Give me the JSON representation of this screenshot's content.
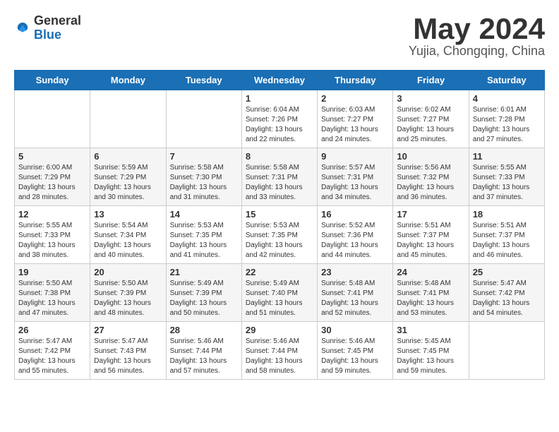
{
  "header": {
    "logo_general": "General",
    "logo_blue": "Blue",
    "month": "May 2024",
    "location": "Yujia, Chongqing, China"
  },
  "days_of_week": [
    "Sunday",
    "Monday",
    "Tuesday",
    "Wednesday",
    "Thursday",
    "Friday",
    "Saturday"
  ],
  "weeks": [
    [
      {
        "day": "",
        "info": ""
      },
      {
        "day": "",
        "info": ""
      },
      {
        "day": "",
        "info": ""
      },
      {
        "day": "1",
        "info": "Sunrise: 6:04 AM\nSunset: 7:26 PM\nDaylight: 13 hours\nand 22 minutes."
      },
      {
        "day": "2",
        "info": "Sunrise: 6:03 AM\nSunset: 7:27 PM\nDaylight: 13 hours\nand 24 minutes."
      },
      {
        "day": "3",
        "info": "Sunrise: 6:02 AM\nSunset: 7:27 PM\nDaylight: 13 hours\nand 25 minutes."
      },
      {
        "day": "4",
        "info": "Sunrise: 6:01 AM\nSunset: 7:28 PM\nDaylight: 13 hours\nand 27 minutes."
      }
    ],
    [
      {
        "day": "5",
        "info": "Sunrise: 6:00 AM\nSunset: 7:29 PM\nDaylight: 13 hours\nand 28 minutes."
      },
      {
        "day": "6",
        "info": "Sunrise: 5:59 AM\nSunset: 7:29 PM\nDaylight: 13 hours\nand 30 minutes."
      },
      {
        "day": "7",
        "info": "Sunrise: 5:58 AM\nSunset: 7:30 PM\nDaylight: 13 hours\nand 31 minutes."
      },
      {
        "day": "8",
        "info": "Sunrise: 5:58 AM\nSunset: 7:31 PM\nDaylight: 13 hours\nand 33 minutes."
      },
      {
        "day": "9",
        "info": "Sunrise: 5:57 AM\nSunset: 7:31 PM\nDaylight: 13 hours\nand 34 minutes."
      },
      {
        "day": "10",
        "info": "Sunrise: 5:56 AM\nSunset: 7:32 PM\nDaylight: 13 hours\nand 36 minutes."
      },
      {
        "day": "11",
        "info": "Sunrise: 5:55 AM\nSunset: 7:33 PM\nDaylight: 13 hours\nand 37 minutes."
      }
    ],
    [
      {
        "day": "12",
        "info": "Sunrise: 5:55 AM\nSunset: 7:33 PM\nDaylight: 13 hours\nand 38 minutes."
      },
      {
        "day": "13",
        "info": "Sunrise: 5:54 AM\nSunset: 7:34 PM\nDaylight: 13 hours\nand 40 minutes."
      },
      {
        "day": "14",
        "info": "Sunrise: 5:53 AM\nSunset: 7:35 PM\nDaylight: 13 hours\nand 41 minutes."
      },
      {
        "day": "15",
        "info": "Sunrise: 5:53 AM\nSunset: 7:35 PM\nDaylight: 13 hours\nand 42 minutes."
      },
      {
        "day": "16",
        "info": "Sunrise: 5:52 AM\nSunset: 7:36 PM\nDaylight: 13 hours\nand 44 minutes."
      },
      {
        "day": "17",
        "info": "Sunrise: 5:51 AM\nSunset: 7:37 PM\nDaylight: 13 hours\nand 45 minutes."
      },
      {
        "day": "18",
        "info": "Sunrise: 5:51 AM\nSunset: 7:37 PM\nDaylight: 13 hours\nand 46 minutes."
      }
    ],
    [
      {
        "day": "19",
        "info": "Sunrise: 5:50 AM\nSunset: 7:38 PM\nDaylight: 13 hours\nand 47 minutes."
      },
      {
        "day": "20",
        "info": "Sunrise: 5:50 AM\nSunset: 7:39 PM\nDaylight: 13 hours\nand 48 minutes."
      },
      {
        "day": "21",
        "info": "Sunrise: 5:49 AM\nSunset: 7:39 PM\nDaylight: 13 hours\nand 50 minutes."
      },
      {
        "day": "22",
        "info": "Sunrise: 5:49 AM\nSunset: 7:40 PM\nDaylight: 13 hours\nand 51 minutes."
      },
      {
        "day": "23",
        "info": "Sunrise: 5:48 AM\nSunset: 7:41 PM\nDaylight: 13 hours\nand 52 minutes."
      },
      {
        "day": "24",
        "info": "Sunrise: 5:48 AM\nSunset: 7:41 PM\nDaylight: 13 hours\nand 53 minutes."
      },
      {
        "day": "25",
        "info": "Sunrise: 5:47 AM\nSunset: 7:42 PM\nDaylight: 13 hours\nand 54 minutes."
      }
    ],
    [
      {
        "day": "26",
        "info": "Sunrise: 5:47 AM\nSunset: 7:42 PM\nDaylight: 13 hours\nand 55 minutes."
      },
      {
        "day": "27",
        "info": "Sunrise: 5:47 AM\nSunset: 7:43 PM\nDaylight: 13 hours\nand 56 minutes."
      },
      {
        "day": "28",
        "info": "Sunrise: 5:46 AM\nSunset: 7:44 PM\nDaylight: 13 hours\nand 57 minutes."
      },
      {
        "day": "29",
        "info": "Sunrise: 5:46 AM\nSunset: 7:44 PM\nDaylight: 13 hours\nand 58 minutes."
      },
      {
        "day": "30",
        "info": "Sunrise: 5:46 AM\nSunset: 7:45 PM\nDaylight: 13 hours\nand 59 minutes."
      },
      {
        "day": "31",
        "info": "Sunrise: 5:45 AM\nSunset: 7:45 PM\nDaylight: 13 hours\nand 59 minutes."
      },
      {
        "day": "",
        "info": ""
      }
    ]
  ]
}
